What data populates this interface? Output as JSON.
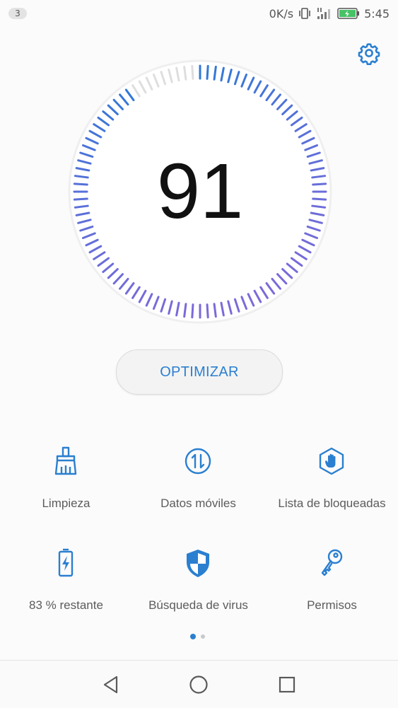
{
  "status_bar": {
    "notification_count": "3",
    "network_speed": "0K/s",
    "time": "5:45",
    "icons": [
      "vibrate-icon",
      "signal-icon",
      "battery-charging-icon"
    ]
  },
  "header": {
    "settings_icon": "gear-icon"
  },
  "dial": {
    "score": "91",
    "score_value": 91,
    "progress_fraction": 0.91
  },
  "optimize_button": {
    "label": "OPTIMIZAR"
  },
  "tools": [
    {
      "label": "Limpieza",
      "icon": "broom-icon"
    },
    {
      "label": "Datos móviles",
      "icon": "data-transfer-icon"
    },
    {
      "label": "Lista de bloqueadas",
      "icon": "blocked-hand-icon"
    },
    {
      "label": "83 % restante",
      "icon": "battery-icon"
    },
    {
      "label": "Búsqueda de virus",
      "icon": "shield-icon"
    },
    {
      "label": "Permisos",
      "icon": "key-icon"
    }
  ],
  "pager": {
    "pages": 2,
    "current": 1
  },
  "nav": {
    "back": "back-icon",
    "home": "home-icon",
    "recents": "recents-icon"
  },
  "colors": {
    "accent": "#2a7fd0",
    "tick_start": "#2f78d8",
    "tick_end": "#7b6ad9",
    "tick_inactive": "#dedede"
  }
}
